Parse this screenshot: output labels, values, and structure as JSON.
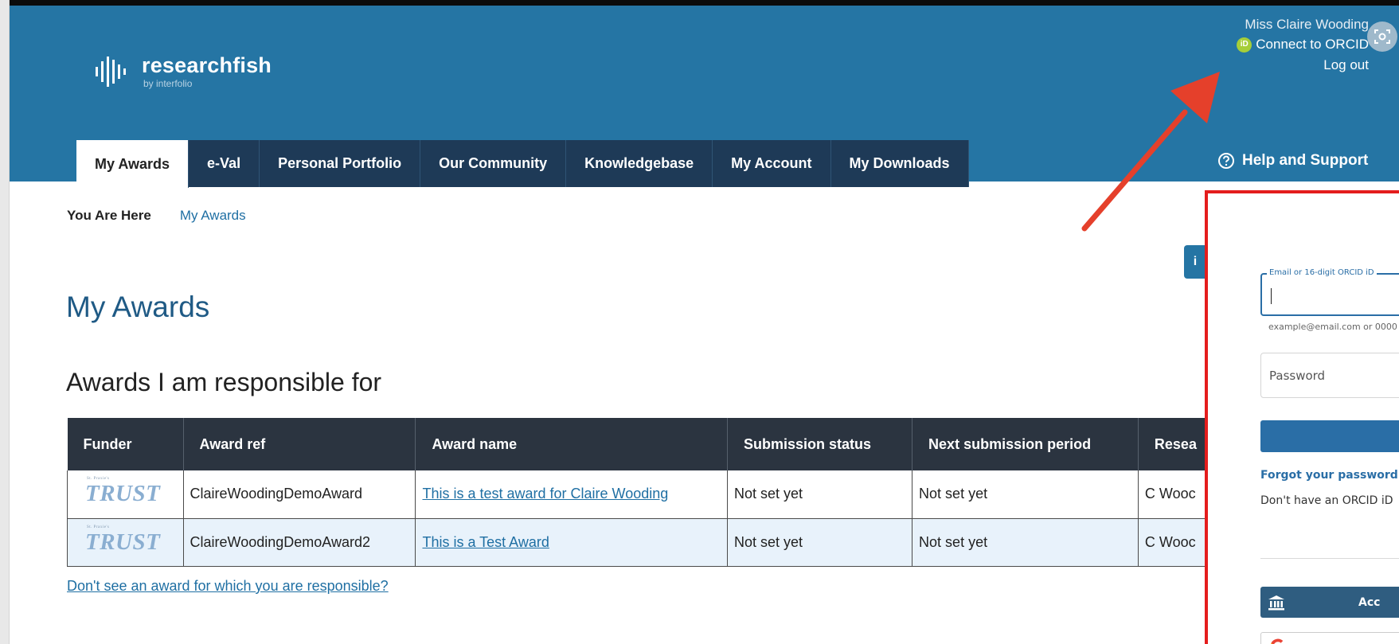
{
  "header": {
    "logo_word": "researchfish",
    "logo_by": "by interfolio",
    "user_name": "Miss Claire Wooding",
    "orcid_badge": "iD",
    "connect_orcid": "Connect to ORCID",
    "logout": "Log out",
    "help": "Help and Support"
  },
  "nav": {
    "tabs": [
      {
        "label": "My Awards",
        "active": true
      },
      {
        "label": "e-Val"
      },
      {
        "label": "Personal Portfolio"
      },
      {
        "label": "Our Community"
      },
      {
        "label": "Knowledgebase"
      },
      {
        "label": "My Account"
      },
      {
        "label": "My Downloads"
      }
    ]
  },
  "breadcrumb": {
    "label": "You Are Here",
    "current": "My Awards"
  },
  "info_icon": "i",
  "page": {
    "title": "My Awards",
    "section_title": "Awards I am responsible for",
    "no_award_link": "Don't see an award for which you are responsible?"
  },
  "table": {
    "headers": [
      "Funder",
      "Award ref",
      "Award name",
      "Submission status",
      "Next submission period",
      "Resea"
    ],
    "rows": [
      {
        "funder_small": "St. Praxie's",
        "funder": "TRUST",
        "ref": "ClaireWoodingDemoAward",
        "name": "This is a test award for Claire Wooding",
        "status": "Not set yet",
        "next": "Not set yet",
        "researcher": "C Wooc"
      },
      {
        "funder_small": "St. Praxie's",
        "funder": "TRUST",
        "ref": "ClaireWoodingDemoAward2",
        "name": "This is a Test Award",
        "status": "Not set yet",
        "next": "Not set yet",
        "researcher": "C Wooc"
      }
    ]
  },
  "orcid_panel": {
    "email_label": "Email or 16-digit ORCID iD",
    "email_hint": "example@email.com or 0000",
    "password_placeholder": "Password",
    "forgot": "Forgot your password o",
    "no_orcid": "Don't have an ORCID iD",
    "institution_label": "Acc"
  },
  "colors": {
    "header_blue": "#2575a4",
    "nav_dark": "#1e3a57",
    "orcid_green": "#a6ce39",
    "annotation_red": "#e41d1d",
    "link_blue": "#1f6fa3"
  }
}
